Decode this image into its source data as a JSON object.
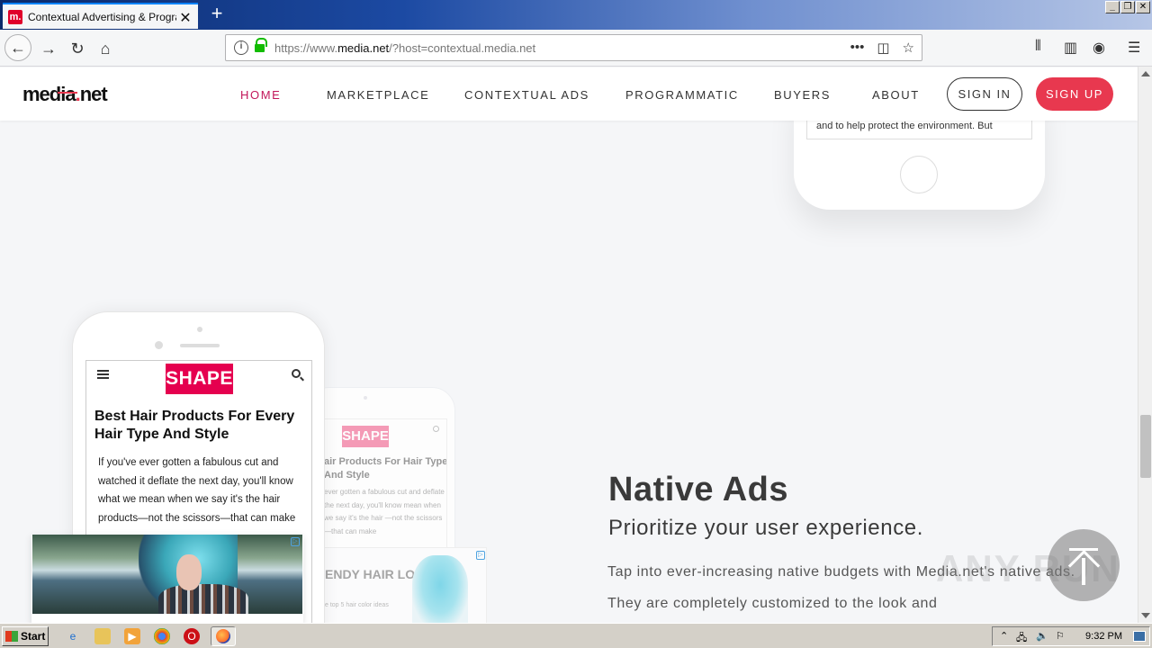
{
  "browser": {
    "tab_title": "Contextual Advertising & Programmatic",
    "tab_favicon": "m.",
    "url_prefix": "https://www.",
    "url_domain": "media.net",
    "url_suffix": "/?host=contextual.media.net",
    "url_more": "•••"
  },
  "site": {
    "logo_main": "media",
    "logo_dot": ".",
    "logo_tld": "net",
    "nav": {
      "home": "HOME",
      "marketplace": "MARKETPLACE",
      "contextual_ads": "CONTEXTUAL ADS",
      "programmatic": "PROGRAMMATIC",
      "buyers": "BUYERS",
      "about": "ABOUT"
    },
    "sign_in": "SIGN IN",
    "sign_up": "SIGN UP"
  },
  "top_phone": {
    "text": "and to help protect the environment. But"
  },
  "main_phone": {
    "logo": "SHAPE",
    "title": "Best Hair Products For Every Hair Type And Style",
    "body": "If you've ever gotten a fabulous cut and watched it deflate the next day, you'll know what we mean when we say it's the hair products—not the scissors—that can make"
  },
  "fade_phone": {
    "logo": "SHAPE",
    "title": "air Products For Hair Type And Style",
    "body": "ever gotten a fabulous cut and deflate the next day, you'll know mean when we say it's the hair —not the scissors—that can make",
    "ad_title": "ENDY HAIR LOR IDEAS",
    "ad_sub": "e top 5 hair color ideas"
  },
  "native_ads": {
    "title": "Native Ads",
    "subtitle": "Prioritize your user experience.",
    "body": "Tap into ever-increasing native budgets with Media.net's native ads. They are completely customized to the look and"
  },
  "watermark": "ANY  RUN",
  "taskbar": {
    "start": "Start",
    "clock": "9:32 PM"
  }
}
